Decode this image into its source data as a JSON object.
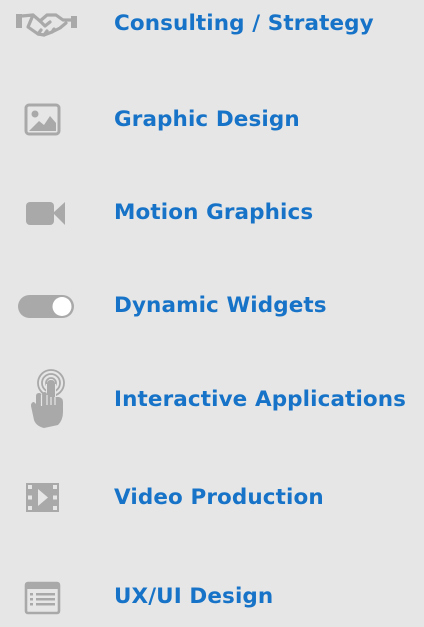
{
  "services": [
    {
      "label": "Consulting / Strategy",
      "icon": "handshake-icon"
    },
    {
      "label": "Graphic Design",
      "icon": "image-icon"
    },
    {
      "label": "Motion Graphics",
      "icon": "video-camera-icon"
    },
    {
      "label": "Dynamic Widgets",
      "icon": "toggle-icon"
    },
    {
      "label": "Interactive Applications",
      "icon": "touch-hand-icon"
    },
    {
      "label": "Video Production",
      "icon": "film-play-icon"
    },
    {
      "label": "UX/UI Design",
      "icon": "list-window-icon"
    }
  ],
  "colors": {
    "background": "#e6e6e6",
    "label": "#1773c7",
    "icon": "#a9a9a9"
  }
}
